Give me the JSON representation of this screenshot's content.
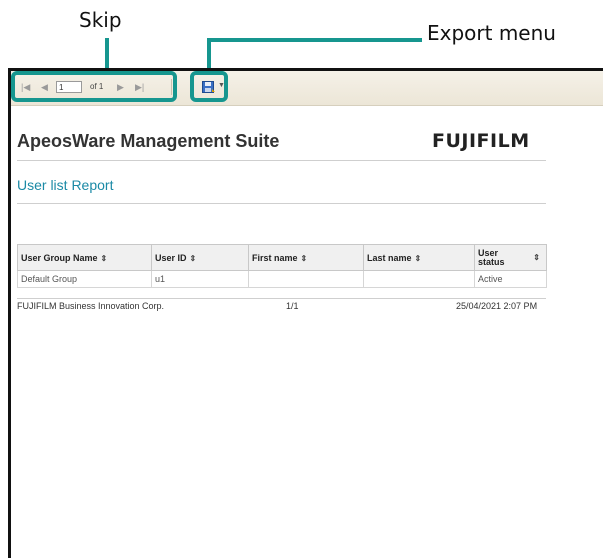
{
  "callouts": {
    "skip": "Skip",
    "export_menu": "Export menu"
  },
  "toolbar": {
    "first_page_icon": "first-page-icon",
    "prev_page_icon": "prev-page-icon",
    "page_value": "1",
    "of_label": "of 1",
    "next_page_icon": "next-page-icon",
    "last_page_icon": "last-page-icon",
    "export_icon": "save-icon"
  },
  "report": {
    "app_title": "ApeosWare Management Suite",
    "brand": "FUJIFILM",
    "report_title": "User list Report",
    "columns": [
      "User Group Name",
      "User ID",
      "First name",
      "Last name",
      "User status"
    ],
    "rows": [
      [
        "Default Group",
        "u1",
        "",
        "",
        "Active"
      ]
    ],
    "footer": {
      "company": "FUJIFILM Business Innovation Corp.",
      "page": "1/1",
      "timestamp": "25/04/2021 2:07 PM"
    }
  },
  "colors": {
    "accent": "#16968f",
    "report_title": "#1b8aa6"
  }
}
